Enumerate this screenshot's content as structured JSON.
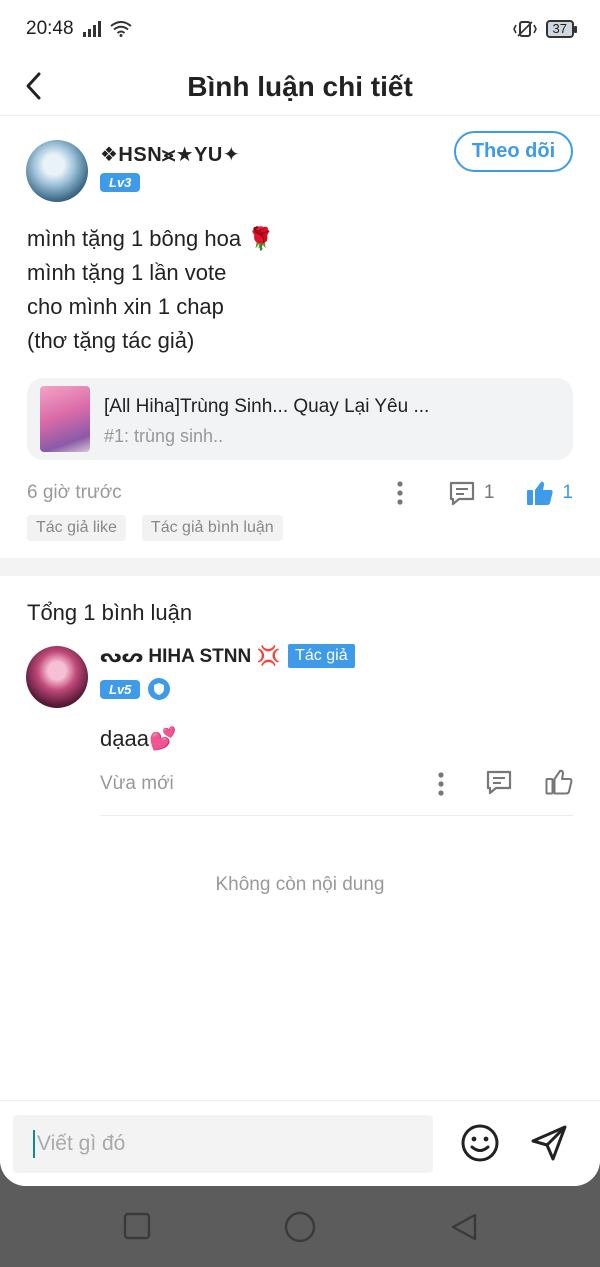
{
  "status_bar": {
    "time": "20:48",
    "battery": "37"
  },
  "header": {
    "title": "Bình luận chi tiết"
  },
  "post": {
    "username": "❖HSN⪤★YU✦",
    "level": "Lv3",
    "follow_label": "Theo dõi",
    "lines": [
      "mình tặng 1 bông hoa 🌹",
      "mình tặng 1 lần vote",
      "cho mình xin 1 chap",
      "(thơ tặng tác giả)"
    ],
    "story": {
      "title": "[All Hiha]Trùng Sinh... Quay Lại Yêu ...",
      "chapter": "#1: trùng sinh.."
    },
    "time": "6 giờ trước",
    "reply_count": "1",
    "like_count": "1",
    "tags": [
      "Tác giả like",
      "Tác giả bình luận"
    ]
  },
  "comments": {
    "total": "Tổng 1 bình luận",
    "items": [
      {
        "username": "ᔓᔕ HIHA STNN 💢",
        "author_badge": "Tác giả",
        "level": "Lv5",
        "text": "dạaa💕",
        "time": "Vừa mới"
      }
    ],
    "end_text": "Không còn nội dung"
  },
  "composer": {
    "placeholder": "Viết gì đó"
  },
  "colors": {
    "accent": "#3d9be9",
    "text": "#222222",
    "muted": "#999999"
  }
}
